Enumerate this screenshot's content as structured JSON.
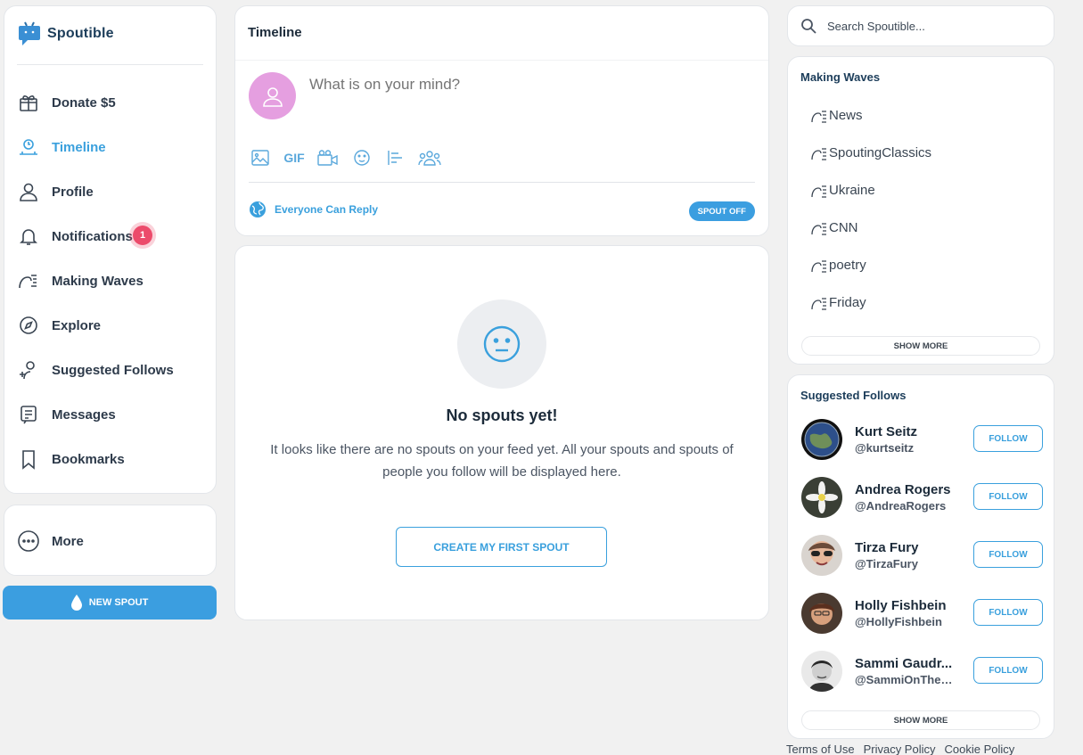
{
  "brand": {
    "name": "Spoutible"
  },
  "nav": {
    "items": [
      {
        "label": "Donate $5",
        "icon": "gift-icon"
      },
      {
        "label": "Timeline",
        "icon": "timeline-icon",
        "active": true
      },
      {
        "label": "Profile",
        "icon": "user-icon"
      },
      {
        "label": "Notifications",
        "icon": "bell-icon",
        "badge": "1"
      },
      {
        "label": "Making Waves",
        "icon": "wave-icon"
      },
      {
        "label": "Explore",
        "icon": "compass-icon"
      },
      {
        "label": "Suggested Follows",
        "icon": "add-user-icon"
      },
      {
        "label": "Messages",
        "icon": "message-icon"
      },
      {
        "label": "Bookmarks",
        "icon": "bookmark-icon"
      }
    ],
    "more_label": "More",
    "new_spout_label": "NEW SPOUT"
  },
  "composer": {
    "title": "Timeline",
    "placeholder": "What is on your mind?",
    "tools": [
      "image-icon",
      "gif-icon",
      "video-icon",
      "emoji-icon",
      "poll-icon",
      "group-icon"
    ],
    "gif_label": "GIF",
    "reply_setting": "Everyone Can Reply",
    "submit_label": "SPOUT OFF"
  },
  "empty_state": {
    "title": "No spouts yet!",
    "text": "It looks like there are no spouts on your feed yet. All your spouts and spouts of people you follow will be displayed here.",
    "button_label": "CREATE MY FIRST SPOUT"
  },
  "search": {
    "placeholder": "Search Spoutible..."
  },
  "making_waves": {
    "title": "Making Waves",
    "items": [
      "News",
      "SpoutingClassics",
      "Ukraine",
      "CNN",
      "poetry",
      "Friday"
    ],
    "show_more": "SHOW MORE"
  },
  "suggested_follows": {
    "title": "Suggested Follows",
    "follow_label": "FOLLOW",
    "users": [
      {
        "name": "Kurt Seitz",
        "handle": "@kurtseitz"
      },
      {
        "name": "Andrea Rogers",
        "handle": "@AndreaRogers"
      },
      {
        "name": "Tirza Fury",
        "handle": "@TirzaFury"
      },
      {
        "name": "Holly Fishbein",
        "handle": "@HollyFishbein"
      },
      {
        "name": "Sammi Gaudr...",
        "handle": "@SammiOnTheM..."
      }
    ],
    "show_more": "SHOW MORE"
  },
  "footer": {
    "links": [
      "Terms of Use",
      "Privacy Policy",
      "Cookie Policy"
    ]
  },
  "colors": {
    "accent": "#3b9ee0",
    "badge": "#ec4b6b",
    "avatar_placeholder": "#e59fe0"
  }
}
